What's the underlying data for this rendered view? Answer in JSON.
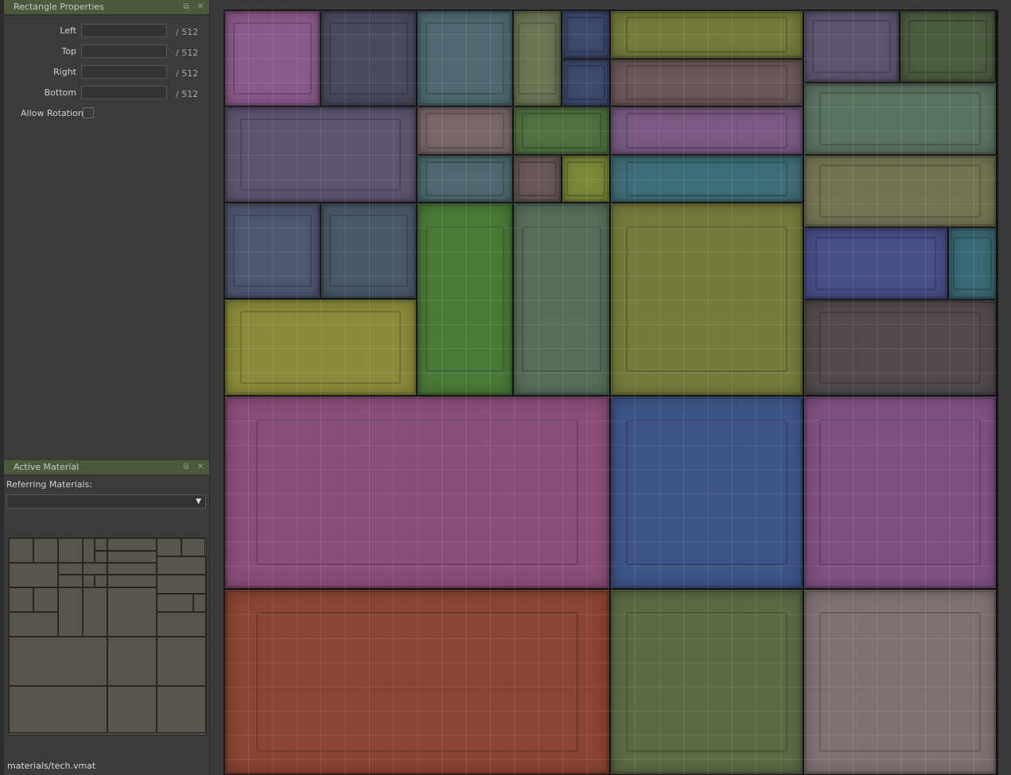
{
  "rectangle_properties": {
    "title": "Rectangle Properties",
    "fields": [
      {
        "label": "Left",
        "value": "",
        "suffix": "/ 512"
      },
      {
        "label": "Top",
        "value": "",
        "suffix": "/ 512"
      },
      {
        "label": "Right",
        "value": "",
        "suffix": "/ 512"
      },
      {
        "label": "Bottom",
        "value": "",
        "suffix": "/ 512"
      }
    ],
    "allow_rotation_label": "Allow Rotation",
    "allow_rotation_checked": false
  },
  "active_material": {
    "title": "Active Material",
    "referring_label": "Referring Materials:",
    "selected_value": "",
    "path": "materials/tech.vmat"
  },
  "icons": {
    "float": "restore-icon",
    "close": "close-icon",
    "dropdown": "chevron-down-icon"
  },
  "atlas_colors": {
    "purple": "#8a5a8a",
    "slate": "#4a4a5e",
    "teal_gray": "#4e6a70",
    "olive_gray": "#6a7654",
    "navy": "#3e4a70",
    "olive": "#767a3a",
    "mauve": "#6a5858",
    "moss": "#4c5c40",
    "sage": "#5a7260",
    "lavender": "#5e5470",
    "rose_gray": "#7a6868",
    "green": "#4f7240",
    "lilac": "#7a5a82",
    "cyan": "#3f6e78",
    "khaki": "#747454",
    "blue_slate": "#4e5670",
    "steel_blue": "#4a5868",
    "forest": "#4a7a38",
    "green_gray": "#566e5a",
    "yellow_olive": "#7a8a38",
    "indigo": "#484e88",
    "aqua": "#3a6a74",
    "mustard": "#8a8a3a",
    "charcoal": "#524a4a",
    "magenta": "#8a4e78",
    "royal": "#3e5488",
    "orchid": "#7e5080",
    "rust": "#8a4432",
    "olive_green": "#5a6a44",
    "warm_gray": "#7e7270"
  }
}
